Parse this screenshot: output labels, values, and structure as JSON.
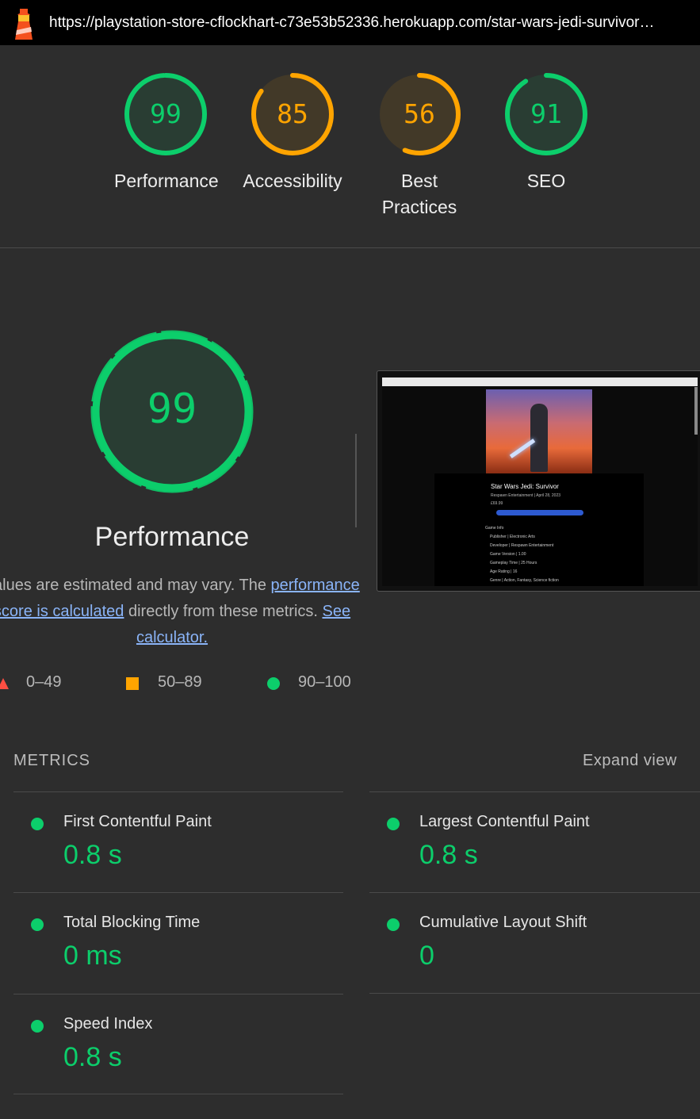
{
  "browser": {
    "url": "https://playstation-store-cflockhart-c73e53b52336.herokuapp.com/star-wars-jedi-survivor…"
  },
  "colors": {
    "pass": "#0cce6b",
    "average": "#ffa400",
    "fail": "#ff4e42",
    "background": "#2d2d2d"
  },
  "scores": [
    {
      "label": "Performance",
      "value": "99",
      "color": "#0cce6b"
    },
    {
      "label": "Accessibility",
      "value": "85",
      "color": "#ffa400"
    },
    {
      "label": "Best Practices",
      "value": "56",
      "color": "#ffa400"
    },
    {
      "label": "SEO",
      "value": "91",
      "color": "#0cce6b"
    }
  ],
  "performance": {
    "score": "99",
    "title": "Performance",
    "desc_text1": "Values are estimated and may vary. The ",
    "desc_link1": "performance score is calculated",
    "desc_text2": " directly from these metrics. ",
    "desc_link2": "See calculator."
  },
  "legend": {
    "fail": "0–49",
    "average": "50–89",
    "pass": "90–100"
  },
  "screenshot_content": {
    "title": "Star Wars Jedi: Survivor",
    "subtitle": "Respawn Entertainment | April 28, 2023",
    "price": "£69.99",
    "section": "Game Info",
    "info_lines": [
      "Publisher | Electronic Arts",
      "Developer | Respawn Entertainment",
      "Game Version | 1.00",
      "Gameplay Time | 25 Hours",
      "Age Rating | 16",
      "Genre | Action, Fantasy, Science fiction"
    ]
  },
  "metrics": {
    "header": "METRICS",
    "expand_label": "Expand view",
    "items": [
      {
        "name": "First Contentful Paint",
        "value": "0.8 s"
      },
      {
        "name": "Largest Contentful Paint",
        "value": "0.8 s"
      },
      {
        "name": "Total Blocking Time",
        "value": "0 ms"
      },
      {
        "name": "Cumulative Layout Shift",
        "value": "0"
      },
      {
        "name": "Speed Index",
        "value": "0.8 s"
      }
    ]
  }
}
